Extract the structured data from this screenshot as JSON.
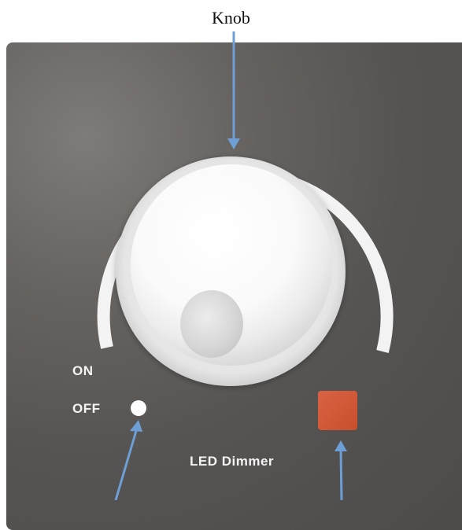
{
  "diagram": {
    "callout_label": "Knob",
    "panel": {
      "on_label": "ON",
      "off_label": "OFF",
      "title": "LED Dimmer"
    },
    "colors": {
      "panel_dark": "#4c4b49",
      "arc": "#f2f2f2",
      "knob": "#ffffff",
      "indicator_dot": "#ffffff",
      "square_button": "#d4552e",
      "arrow": "#6d9fd6"
    },
    "icons": {
      "knob": "rotary-knob-icon",
      "indicator": "indicator-dot-icon",
      "button": "square-button-icon",
      "arrow": "pointer-arrow-icon"
    }
  }
}
